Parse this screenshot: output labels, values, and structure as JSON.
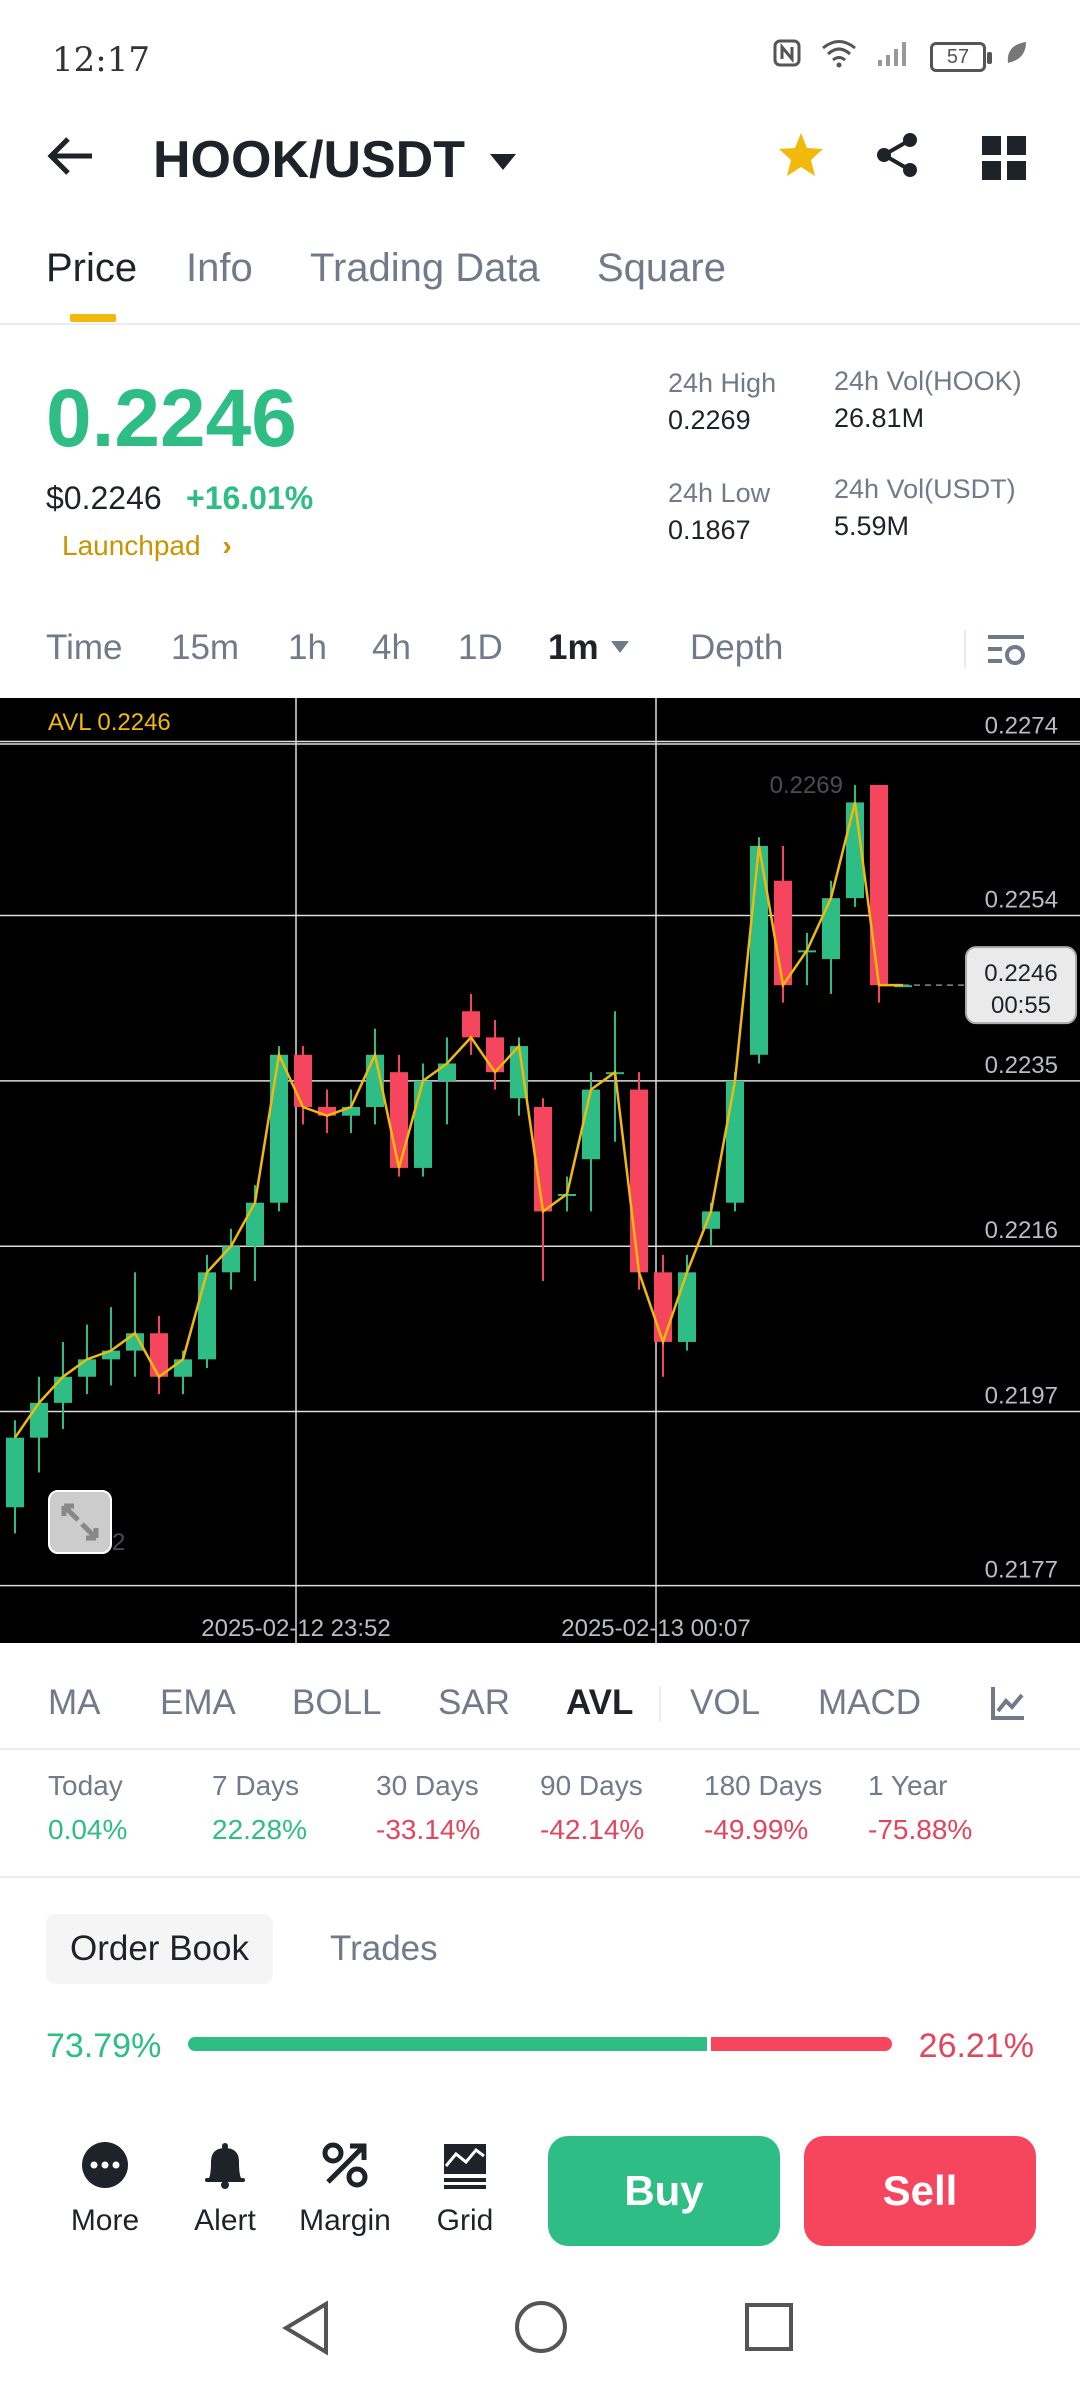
{
  "status": {
    "time": "12:17",
    "battery": "57"
  },
  "header": {
    "pair": "HOOK/USDT"
  },
  "tabs": [
    "Price",
    "Info",
    "Trading Data",
    "Square"
  ],
  "price": {
    "last": "0.2246",
    "usd": "$0.2246",
    "change": "+16.01%",
    "launchpad": "Launchpad",
    "high_label": "24h High",
    "high": "0.2269",
    "low_label": "24h Low",
    "low": "0.1867",
    "vol_base_label": "24h Vol(HOOK)",
    "vol_base": "26.81M",
    "vol_quote_label": "24h Vol(USDT)",
    "vol_quote": "5.59M"
  },
  "timeframes": [
    "Time",
    "15m",
    "1h",
    "4h",
    "1D",
    "1m",
    "Depth"
  ],
  "chart_data": {
    "type": "candlestick",
    "indicator_label": "AVL 0.2246",
    "y_ticks": [
      "0.2274",
      "0.2254",
      "0.2235",
      "0.2216",
      "0.2197",
      "0.2177"
    ],
    "x_ticks": [
      "2025-02-12 23:52",
      "2025-02-13 00:07"
    ],
    "max_label": "0.2269",
    "min_label": "0.2182",
    "current_price": "0.2246",
    "countdown": "00:55",
    "ylim": [
      0.2175,
      0.2279
    ],
    "candles": [
      [
        0.2186,
        0.2194,
        0.2183,
        0.2196
      ],
      [
        0.2194,
        0.2198,
        0.219,
        0.2201
      ],
      [
        0.2198,
        0.2201,
        0.2195,
        0.2205
      ],
      [
        0.2201,
        0.2203,
        0.2199,
        0.2207
      ],
      [
        0.2203,
        0.2204,
        0.22,
        0.2209
      ],
      [
        0.2204,
        0.2206,
        0.2201,
        0.2213
      ],
      [
        0.2206,
        0.2201,
        0.2199,
        0.2208
      ],
      [
        0.2201,
        0.2203,
        0.2199,
        0.2204
      ],
      [
        0.2203,
        0.2213,
        0.2202,
        0.2215
      ],
      [
        0.2213,
        0.2216,
        0.2211,
        0.2218
      ],
      [
        0.2216,
        0.2221,
        0.2212,
        0.2223
      ],
      [
        0.2221,
        0.2238,
        0.222,
        0.2239
      ],
      [
        0.2238,
        0.2232,
        0.223,
        0.2239
      ],
      [
        0.2232,
        0.2231,
        0.2229,
        0.2234
      ],
      [
        0.2231,
        0.2232,
        0.2229,
        0.2234
      ],
      [
        0.2232,
        0.2238,
        0.223,
        0.2241
      ],
      [
        0.2236,
        0.2225,
        0.2224,
        0.2238
      ],
      [
        0.2225,
        0.2235,
        0.2224,
        0.2237
      ],
      [
        0.2235,
        0.2237,
        0.223,
        0.224
      ],
      [
        0.2243,
        0.224,
        0.2238,
        0.2245
      ],
      [
        0.224,
        0.2236,
        0.2234,
        0.2242
      ],
      [
        0.2233,
        0.2239,
        0.2231,
        0.224
      ],
      [
        0.2232,
        0.222,
        0.2212,
        0.2233
      ],
      [
        0.2222,
        0.2222,
        0.222,
        0.2224
      ],
      [
        0.2226,
        0.2234,
        0.222,
        0.2236
      ],
      [
        0.2236,
        0.2236,
        0.2228,
        0.2243
      ],
      [
        0.2234,
        0.2213,
        0.2211,
        0.2236
      ],
      [
        0.2213,
        0.2205,
        0.2201,
        0.2215
      ],
      [
        0.2205,
        0.2213,
        0.2204,
        0.2215
      ],
      [
        0.2218,
        0.222,
        0.2216,
        0.2221
      ],
      [
        0.2221,
        0.2235,
        0.222,
        0.2236
      ],
      [
        0.2238,
        0.2262,
        0.2237,
        0.2263
      ],
      [
        0.2258,
        0.2246,
        0.2244,
        0.2262
      ],
      [
        0.225,
        0.225,
        0.2246,
        0.2252
      ],
      [
        0.2249,
        0.2256,
        0.2245,
        0.2258
      ],
      [
        0.2256,
        0.2267,
        0.2255,
        0.2269
      ],
      [
        0.2269,
        0.2246,
        0.2244,
        0.2269
      ],
      [
        0.2246,
        0.2246,
        0.2246,
        0.2246
      ]
    ]
  },
  "indicators": [
    "MA",
    "EMA",
    "BOLL",
    "SAR",
    "AVL",
    "VOL",
    "MACD"
  ],
  "performance": [
    {
      "label": "Today",
      "value": "0.04%",
      "dir": "pos"
    },
    {
      "label": "7 Days",
      "value": "22.28%",
      "dir": "pos"
    },
    {
      "label": "30 Days",
      "value": "-33.14%",
      "dir": "neg"
    },
    {
      "label": "90 Days",
      "value": "-42.14%",
      "dir": "neg"
    },
    {
      "label": "180 Days",
      "value": "-49.99%",
      "dir": "neg"
    },
    {
      "label": "1 Year",
      "value": "-75.88%",
      "dir": "neg"
    }
  ],
  "orderbook": {
    "tab_active": "Order Book",
    "tab_other": "Trades",
    "buy_pct": "73.79%",
    "sell_pct": "26.21%",
    "buy_ratio": 0.7379
  },
  "actions": {
    "more": "More",
    "alert": "Alert",
    "margin": "Margin",
    "grid": "Grid",
    "buy": "Buy",
    "sell": "Sell"
  },
  "colors": {
    "up": "#2ebd85",
    "down": "#f6465d",
    "accent": "#f0b90b"
  }
}
